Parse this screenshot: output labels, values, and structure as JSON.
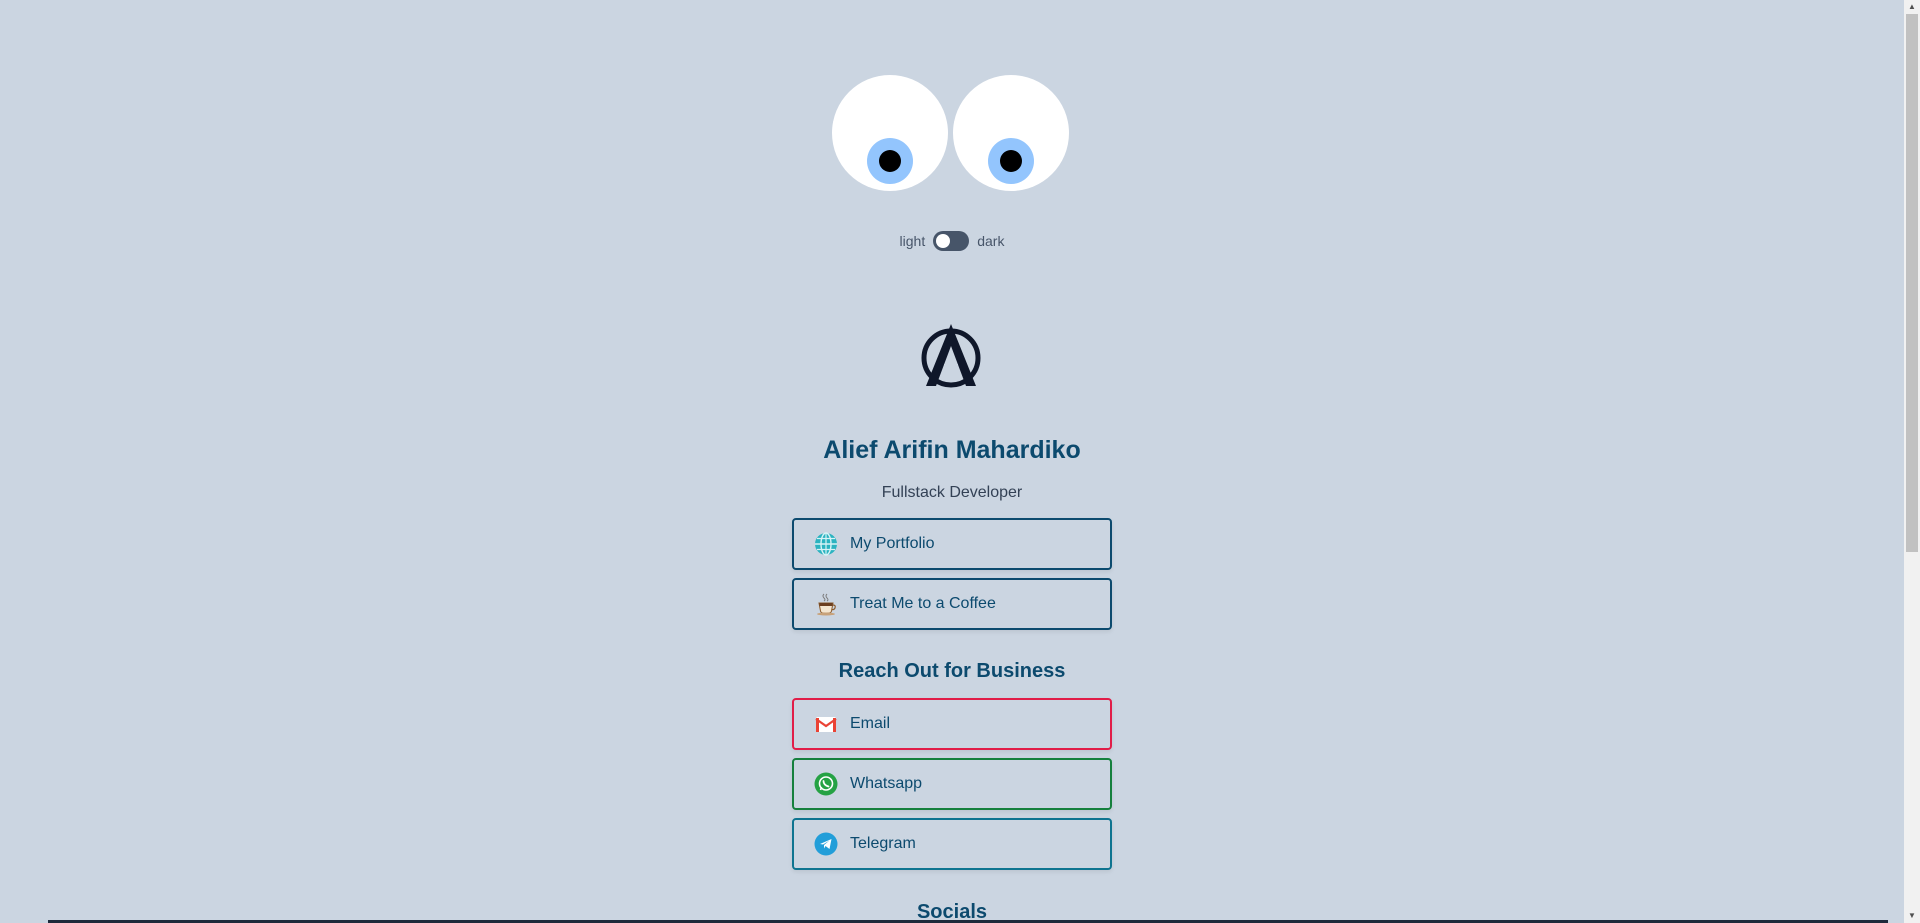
{
  "theme_toggle": {
    "light_label": "light",
    "dark_label": "dark"
  },
  "profile": {
    "name": "Alief Arifin Mahardiko",
    "role": "Fullstack Developer"
  },
  "links": {
    "portfolio": "My Portfolio",
    "coffee": "Treat Me to a Coffee"
  },
  "business": {
    "title": "Reach Out for Business",
    "email": "Email",
    "whatsapp": "Whatsapp",
    "telegram": "Telegram"
  },
  "socials": {
    "title": "Socials"
  },
  "colors": {
    "background": "#cbd5e1",
    "primary": "#0c4a6e",
    "email": "#e11d48",
    "whatsapp": "#15803d",
    "telegram": "#0e7490"
  },
  "icons": {
    "portfolio": "globe-icon",
    "coffee": "coffee-cup-icon",
    "email": "gmail-icon",
    "whatsapp": "whatsapp-icon",
    "telegram": "telegram-icon"
  }
}
